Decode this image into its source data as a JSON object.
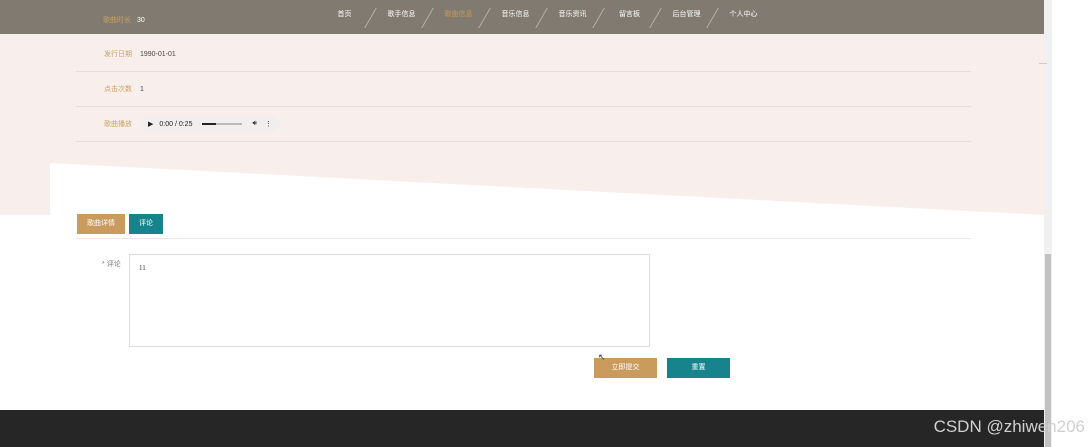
{
  "header": {
    "top_info_label": "歌曲时长",
    "top_info_value": "30"
  },
  "nav": {
    "items": [
      "首页",
      "歌手信息",
      "歌曲信息",
      "音乐信息",
      "音乐资讯",
      "留言板",
      "后台管理",
      "个人中心"
    ],
    "active_index": 2
  },
  "details": {
    "release_date_label": "发行日期",
    "release_date_value": "1990-01-01",
    "clicks_label": "点击次数",
    "clicks_value": "1",
    "play_label": "歌曲播放",
    "audio_time": "0:00 / 0:25",
    "audio_progress": 0.0
  },
  "tabs": {
    "info_label": "歌曲详情",
    "comment_label": "评论"
  },
  "form": {
    "required_mark": "*",
    "comment_label": "评论",
    "comment_value": "11"
  },
  "buttons": {
    "submit_label": "立即提交",
    "reset_label": "重置"
  },
  "watermark": "CSDN @zhiwen206",
  "colors": {
    "nav_bg": "#817a71",
    "accent_gold": "#c99b5c",
    "accent_teal": "#17848d",
    "info_bg": "#f8efec",
    "footer_bg": "#262626"
  }
}
